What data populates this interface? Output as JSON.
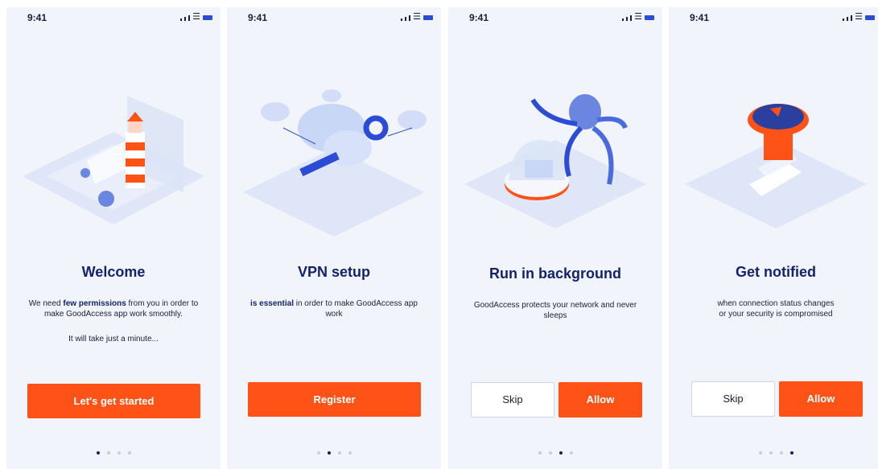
{
  "status_bar": {
    "time": "9:41"
  },
  "screens": [
    {
      "title": "Welcome",
      "desc_pre": "We need ",
      "desc_bold": "few permissions",
      "desc_post": " from you in order to make GoodAccess app work smoothly.",
      "desc2": "It will take just a minute...",
      "button": "Let's get started",
      "active_dot": 0
    },
    {
      "title": "VPN setup",
      "desc_bold": "is essential",
      "desc_post": " in order to make GoodAccess app work",
      "button": "Register",
      "active_dot": 1
    },
    {
      "title": "Run in background",
      "desc": "GoodAccess protects your network and never sleeps",
      "skip": "Skip",
      "allow": "Allow",
      "active_dot": 2
    },
    {
      "title": "Get notified",
      "desc_line1": "when connection status changes",
      "desc_line2": "or your security is compromised",
      "skip": "Skip",
      "allow": "Allow",
      "active_dot": 3
    }
  ],
  "colors": {
    "accent": "#ff5216",
    "title": "#13236b",
    "background": "#f1f4fb",
    "dot_active": "#13236b",
    "dot_inactive": "#c7cde2"
  }
}
